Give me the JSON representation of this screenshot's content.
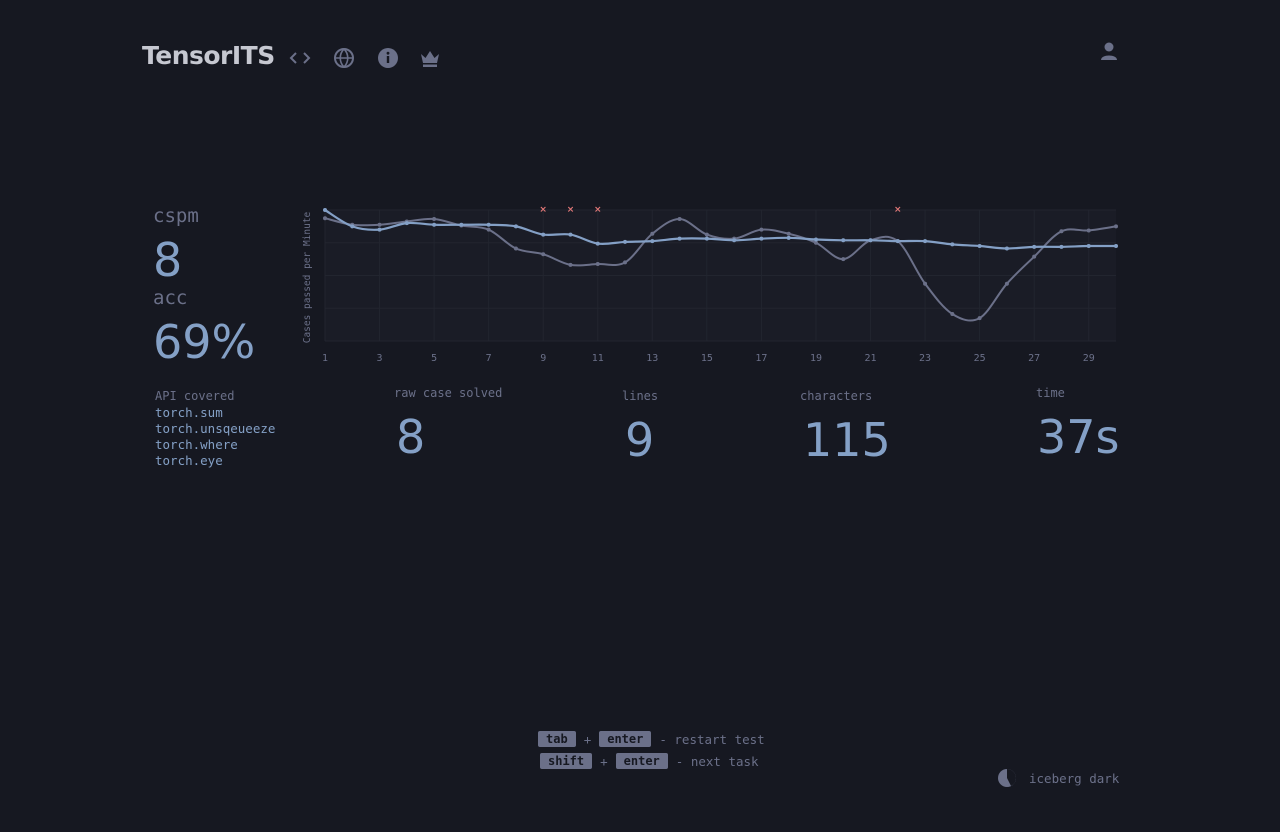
{
  "app": {
    "title": "TensorITS"
  },
  "header": {
    "icons": [
      "code-icon",
      "globe-icon",
      "info-icon",
      "crown-icon"
    ],
    "user_icon": "user-icon"
  },
  "stats": {
    "cspm_label": "cspm",
    "cspm_value": "8",
    "acc_label": "acc",
    "acc_value": "69%",
    "api_label": "API covered",
    "api_items": [
      "torch.sum",
      "torch.unsqeueeze",
      "torch.where",
      "torch.eye"
    ],
    "raw_label": "raw case solved",
    "raw_value": "8",
    "lines_label": "lines",
    "lines_value": "9",
    "chars_label": "characters",
    "chars_value": "115",
    "time_label": "time",
    "time_value": "37s"
  },
  "chart_data": {
    "type": "line",
    "ylabel": "Cases passed per Minute",
    "xlabel": "",
    "x": [
      1,
      2,
      3,
      4,
      5,
      6,
      7,
      8,
      9,
      10,
      11,
      12,
      13,
      14,
      15,
      16,
      17,
      18,
      19,
      20,
      21,
      22,
      23,
      24,
      25,
      26,
      27,
      28,
      29,
      30
    ],
    "xticks": [
      1,
      3,
      5,
      7,
      9,
      11,
      13,
      15,
      17,
      19,
      21,
      23,
      25,
      27,
      29
    ],
    "ylim": [
      0,
      16
    ],
    "grid": true,
    "series": [
      {
        "name": "",
        "color": "#84a0c6",
        "values": [
          16,
          14,
          13.6,
          14.4,
          14.2,
          14.2,
          14.2,
          14,
          13,
          13,
          11.9,
          12.1,
          12.2,
          12.5,
          12.5,
          12.3,
          12.5,
          12.6,
          12.4,
          12.3,
          12.3,
          12.2,
          12.2,
          11.8,
          11.6,
          11.3,
          11.5,
          11.5,
          11.6,
          11.6
        ]
      },
      {
        "name": "",
        "color": "#6b7089",
        "values": [
          15,
          14.2,
          14.2,
          14.6,
          14.9,
          14.1,
          13.6,
          11.3,
          10.6,
          9.3,
          9.4,
          9.6,
          13.1,
          14.9,
          13,
          12.5,
          13.6,
          13.1,
          12,
          10,
          12.3,
          12.2,
          7,
          3.3,
          2.8,
          7,
          10.3,
          13.4,
          13.5,
          14
        ]
      }
    ],
    "errors": [
      9,
      10,
      11,
      22
    ],
    "error_color": "#e27878"
  },
  "footer": {
    "row1": {
      "key1": "tab",
      "plus": "+",
      "key2": "enter",
      "desc": "- restart test"
    },
    "row2": {
      "key1": "shift",
      "plus": "+",
      "key2": "enter",
      "desc": "- next task"
    },
    "theme_name": "iceberg dark",
    "theme_icon": "palette-icon"
  },
  "colors": {
    "background": "#161821",
    "main": "#84a0c6",
    "sub": "#6b7089",
    "text": "#c6c8d1",
    "error": "#e27878"
  }
}
